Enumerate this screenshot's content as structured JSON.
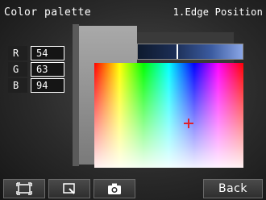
{
  "header": {
    "title": "Color palette",
    "tool_name": "1.Edge Position"
  },
  "rgb": [
    {
      "label": "R",
      "value": "54"
    },
    {
      "label": "G",
      "value": "63"
    },
    {
      "label": "B",
      "value": "94"
    }
  ],
  "colors": {
    "selected": "#36405e",
    "crosshair": "#e0222a",
    "text": "#ffffff"
  },
  "toolbar": {
    "buttons": [
      {
        "icon": "frame-icon"
      },
      {
        "icon": "zoom-area-icon"
      },
      {
        "icon": "camera-icon"
      }
    ],
    "back_label": "Back"
  }
}
